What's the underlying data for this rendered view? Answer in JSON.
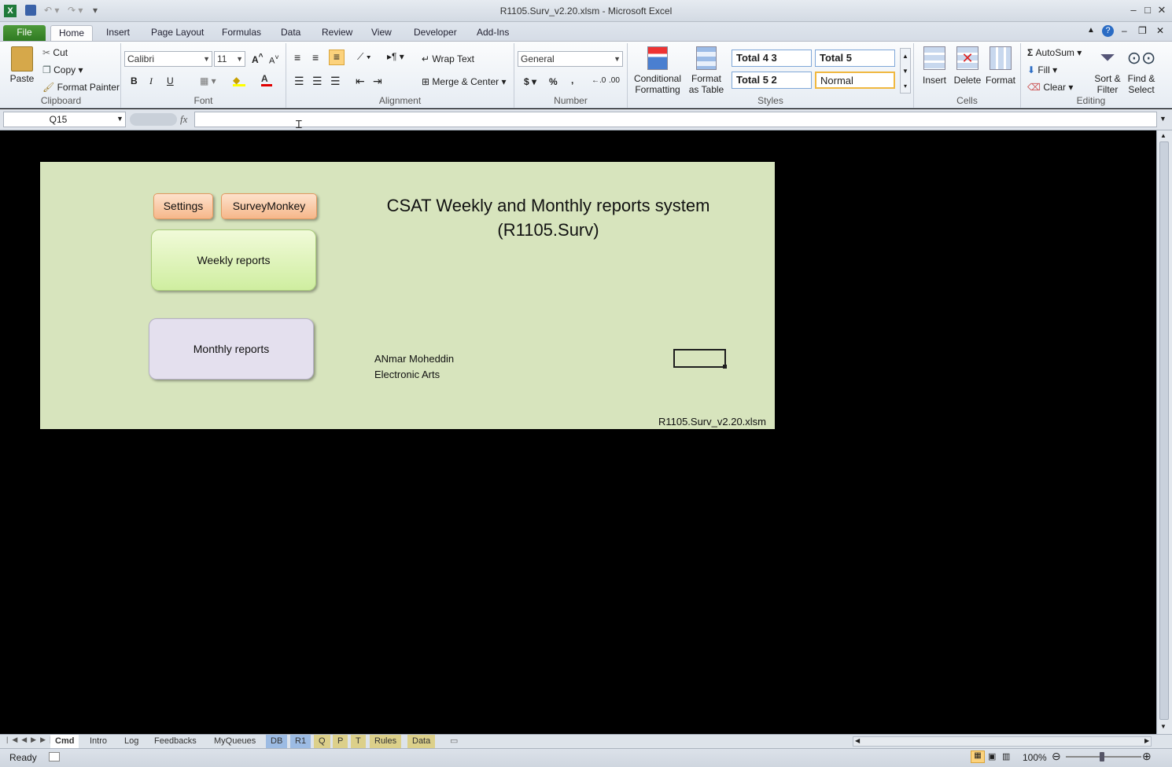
{
  "window": {
    "title": "R1105.Surv_v2.20.xlsm  -  Microsoft Excel"
  },
  "tabs": [
    "File",
    "Home",
    "Insert",
    "Page Layout",
    "Formulas",
    "Data",
    "Review",
    "View",
    "Developer",
    "Add-Ins"
  ],
  "ribbon": {
    "clipboard": {
      "paste": "Paste",
      "cut": "Cut",
      "copy": "Copy",
      "format_painter": "Format Painter",
      "label": "Clipboard"
    },
    "font": {
      "name": "Calibri",
      "size": "11",
      "bold": "B",
      "italic": "I",
      "underline": "U",
      "label": "Font"
    },
    "alignment": {
      "wrap": "Wrap Text",
      "merge": "Merge & Center",
      "label": "Alignment"
    },
    "number": {
      "format": "General",
      "currency": "$",
      "percent": "%",
      "comma": ",",
      "label": "Number"
    },
    "styles": {
      "conditional": "Conditional",
      "conditional2": "Formatting",
      "format_table": "Format",
      "format_table2": "as Table",
      "s1": "Total 4 3",
      "s2": "Total 5",
      "s3": "Total 5 2",
      "s4": "Normal",
      "label": "Styles"
    },
    "cells": {
      "insert": "Insert",
      "delete": "Delete",
      "format": "Format",
      "label": "Cells"
    },
    "editing": {
      "autosum": "AutoSum",
      "fill": "Fill",
      "clear": "Clear",
      "sort": "Sort &",
      "sort2": "Filter",
      "find": "Find &",
      "find2": "Select",
      "label": "Editing"
    }
  },
  "formula_bar": {
    "name_box": "Q15",
    "fx": "fx",
    "value": ""
  },
  "sheet": {
    "buttons": {
      "settings": "Settings",
      "surveymonkey": "SurveyMonkey",
      "weekly": "Weekly reports",
      "monthly": "Monthly reports"
    },
    "title_line1": "CSAT Weekly and Monthly reports system",
    "title_line2": "(R1105.Surv)",
    "author": "ANmar Moheddin",
    "company": "Electronic Arts",
    "filename": "R1105.Surv_v2.20.xlsm"
  },
  "sheet_tabs": [
    "Cmd",
    "Intro",
    "Log",
    "Feedbacks",
    "MyQueues",
    "DB",
    "R1",
    "Q",
    "P",
    "T",
    "Rules",
    "Data"
  ],
  "status": {
    "ready": "Ready",
    "zoom": "100%"
  }
}
